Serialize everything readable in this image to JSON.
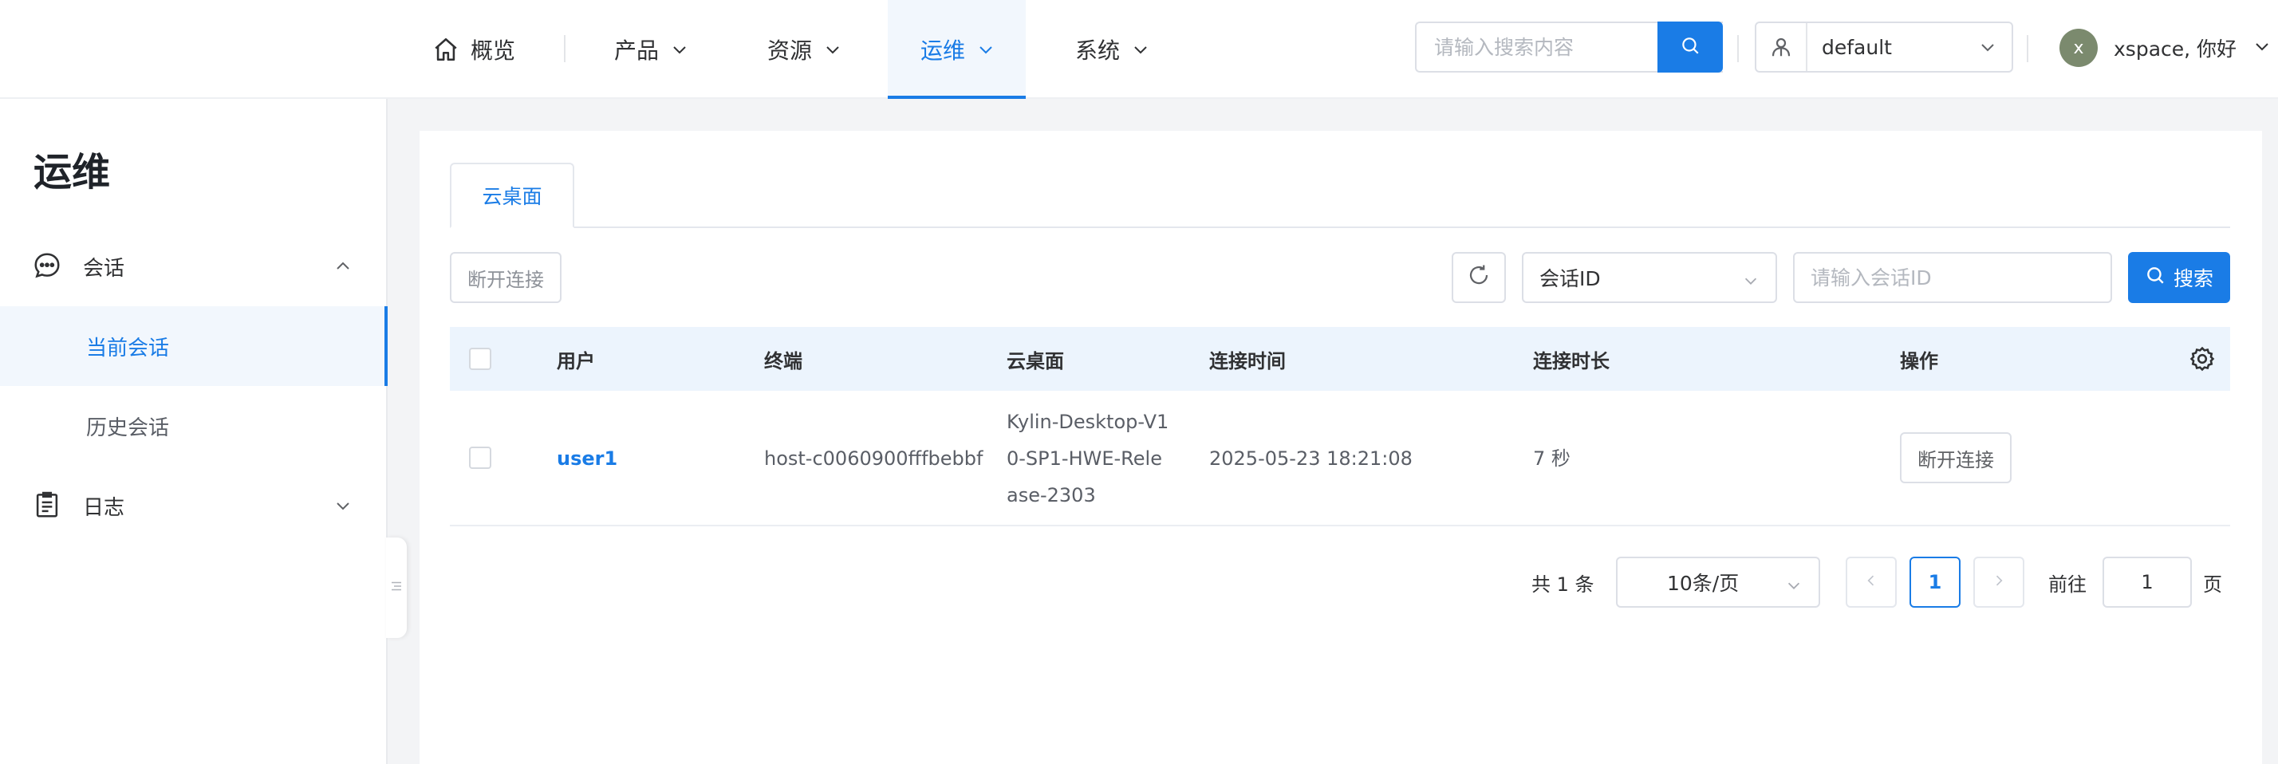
{
  "nav": {
    "items": [
      {
        "label": "概览",
        "icon": "home-icon"
      },
      {
        "label": "产品",
        "icon": "chevron-down-icon"
      },
      {
        "label": "资源",
        "icon": "chevron-down-icon"
      },
      {
        "label": "运维",
        "icon": "chevron-down-icon"
      },
      {
        "label": "系统",
        "icon": "chevron-down-icon"
      }
    ],
    "active": "运维",
    "search_placeholder": "请输入搜索内容",
    "namespace": "default",
    "user_initial": "x",
    "user_greeting": "xspace, 你好"
  },
  "sidebar": {
    "title": "运维",
    "groups": [
      {
        "label": "会话",
        "icon": "chat-icon",
        "expanded": true,
        "items": [
          {
            "label": "当前会话",
            "active": true
          },
          {
            "label": "历史会话",
            "active": false
          }
        ]
      },
      {
        "label": "日志",
        "icon": "clipboard-icon",
        "expanded": false,
        "items": []
      }
    ]
  },
  "main": {
    "tab": "云桌面",
    "toolbar": {
      "disconnect_label": "断开连接",
      "filter_field": "会话ID",
      "filter_placeholder": "请输入会话ID",
      "search_label": "搜索"
    },
    "table": {
      "columns": [
        "用户",
        "终端",
        "云桌面",
        "连接时间",
        "连接时长",
        "操作"
      ],
      "rows": [
        {
          "user": "user1",
          "terminal": "host-c0060900fffbebbf",
          "desktop_lines": [
            "Kylin-Desktop-V1",
            "0-SP1-HWE-Rele",
            "ase-2303"
          ],
          "connect_time": "2025-05-23 18:21:08",
          "duration": "7 秒",
          "action": "断开连接"
        }
      ]
    },
    "pagination": {
      "total_text": "共 1 条",
      "page_size": "10条/页",
      "current_page": "1",
      "goto_label": "前往",
      "goto_value": "1",
      "page_unit": "页"
    }
  },
  "colors": {
    "primary": "#1a7ce6",
    "active_bg": "#f2f7fd",
    "header_bg": "#ecf4fd"
  }
}
